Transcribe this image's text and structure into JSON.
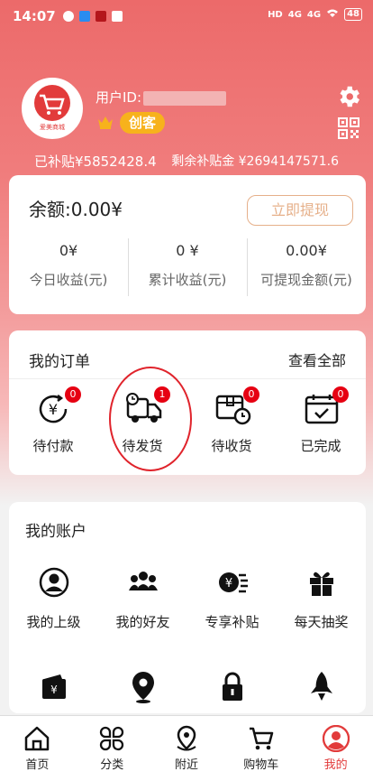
{
  "status_bar": {
    "time": "14:07",
    "network": "4G",
    "battery": "48"
  },
  "profile": {
    "user_id_label": "用户ID:",
    "avatar_text": "爱美商城",
    "level_badge": "创客",
    "subsidized": "已补贴¥5852428.4",
    "remaining_subsidy": "剩余补贴金 ¥2694147571.6"
  },
  "balance_card": {
    "balance": "余额:0.00¥",
    "withdraw_button": "立即提现",
    "stats": [
      {
        "value": "0¥",
        "label": "今日收益(元)"
      },
      {
        "value": "0 ¥",
        "label": "累计收益(元)"
      },
      {
        "value": "0.00¥",
        "label": "可提现金额(元)"
      }
    ]
  },
  "orders": {
    "title": "我的订单",
    "view_all": "查看全部",
    "items": [
      {
        "label": "待付款",
        "count": "0"
      },
      {
        "label": "待发货",
        "count": "1"
      },
      {
        "label": "待收货",
        "count": "0"
      },
      {
        "label": "已完成",
        "count": "0"
      }
    ]
  },
  "account": {
    "title": "我的账户",
    "items": [
      {
        "label": "我的上级",
        "icon": "user-icon"
      },
      {
        "label": "我的好友",
        "icon": "group-icon"
      },
      {
        "label": "专享补贴",
        "icon": "subsidy-icon"
      },
      {
        "label": "每天抽奖",
        "icon": "gift-icon"
      },
      {
        "label": "",
        "icon": "wallet-icon"
      },
      {
        "label": "",
        "icon": "location-pin-icon"
      },
      {
        "label": "",
        "icon": "lock-icon"
      },
      {
        "label": "",
        "icon": "rocket-icon"
      }
    ]
  },
  "tabbar": [
    {
      "label": "首页",
      "icon": "home-icon"
    },
    {
      "label": "分类",
      "icon": "category-icon"
    },
    {
      "label": "附近",
      "icon": "nearby-icon"
    },
    {
      "label": "购物车",
      "icon": "cart-icon"
    },
    {
      "label": "我的",
      "icon": "profile-icon",
      "active": true
    }
  ],
  "colors": {
    "primary": "#ec6a6a",
    "accent": "#e23b3b",
    "badge": "#f7b21c",
    "withdraw": "#e6b08a"
  }
}
